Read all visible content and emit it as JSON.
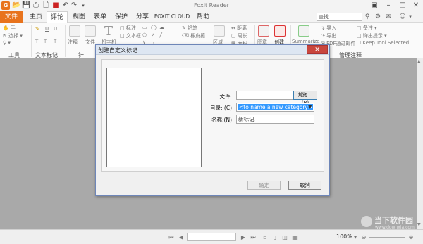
{
  "app": {
    "title": "Foxit Reader"
  },
  "menu": {
    "tabs": [
      "文件",
      "主页",
      "评论",
      "视图",
      "表单",
      "保护",
      "分享",
      "FOXIT CLOUD",
      "帮助"
    ],
    "active": "评论",
    "search_placeholder": "查找"
  },
  "ribbon": {
    "tools": {
      "hand": "手",
      "select": "选择",
      "group": "工具"
    },
    "text_markup": {
      "group": "文本标记"
    },
    "pin": {
      "note": "注释",
      "file": "文件",
      "group": "针"
    },
    "typewriter": {
      "label": "打字机",
      "tag": "标注",
      "textbox": "文本框"
    },
    "drawing": {
      "pencil": "铅笔",
      "eraser": "橡皮擦"
    },
    "measure": {
      "area": "区域",
      "distance": "距离",
      "perimeter": "周长",
      "area2": "面积"
    },
    "stamp": {
      "label": "图章",
      "create": "创建"
    },
    "summarize": "Summarize",
    "manage": {
      "import": "导入",
      "export": "导出",
      "email": "FDF通过邮件",
      "notes": "备注",
      "popup": "弹出提示",
      "keep_tool": "Keep Tool Selected",
      "group": "管理注释"
    }
  },
  "dialog": {
    "title": "创建自定义标记",
    "file_label": "文件:",
    "file_value": "",
    "browse_label": "浏览....(B)",
    "dir_label": "目录: (C)",
    "dir_value": "<to name a new category>",
    "name_label": "名称:(N)",
    "name_value": "新标记",
    "ok_label": "确定",
    "cancel_label": "取消"
  },
  "statusbar": {
    "zoom": "100%"
  },
  "watermark": {
    "site_cn": "当下软件园",
    "site_en": "www.downxia.com"
  },
  "colors": {
    "file_tab": "#e8731c",
    "workspace": "#a9a9a9",
    "dialog_border": "#6e86b8",
    "close_button": "#c9463d",
    "selection": "#3399ff"
  }
}
